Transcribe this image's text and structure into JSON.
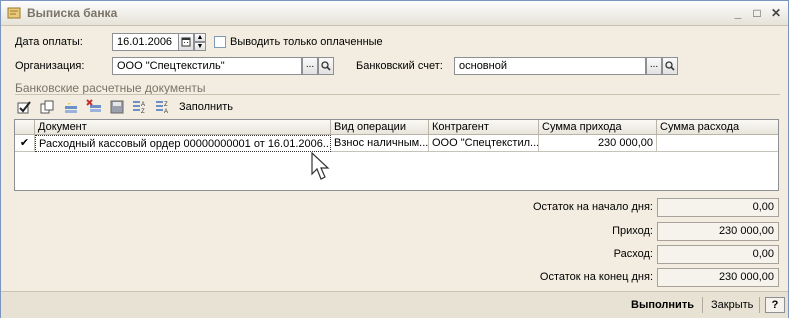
{
  "window": {
    "title": "Выписка банка"
  },
  "form": {
    "payment_date_label": "Дата оплаты:",
    "payment_date_value": "16.01.2006",
    "only_paid_label": "Выводить только оплаченные",
    "org_label": "Организация:",
    "org_value": "ООО \"Спецтекстиль\"",
    "account_label": "Банковский счет:",
    "account_value": "основной",
    "ellipsis": "..."
  },
  "section": {
    "title": "Банковские расчетные документы",
    "fill_label": "Заполнить"
  },
  "table": {
    "columns": [
      "Документ",
      "Вид операции",
      "Контрагент",
      "Сумма прихода",
      "Сумма расхода"
    ],
    "rows": [
      {
        "check": "✔",
        "document": "Расходный кассовый ордер 00000000001 от 16.01.2006...",
        "operation": "Взнос наличным...",
        "counterparty": "ООО \"Спецтекстил...",
        "income": "230 000,00",
        "expense": ""
      }
    ]
  },
  "totals": {
    "start_label": "Остаток на начало дня:",
    "start_value": "0,00",
    "income_label": "Приход:",
    "income_value": "230 000,00",
    "expense_label": "Расход:",
    "expense_value": "0,00",
    "end_label": "Остаток на конец дня:",
    "end_value": "230 000,00"
  },
  "footer": {
    "run_label": "Выполнить",
    "close_label": "Закрыть",
    "help_label": "?"
  },
  "colors": {
    "accent": "#316ac5",
    "window_bg": "#f2ede0",
    "section_title": "#7a7468"
  }
}
